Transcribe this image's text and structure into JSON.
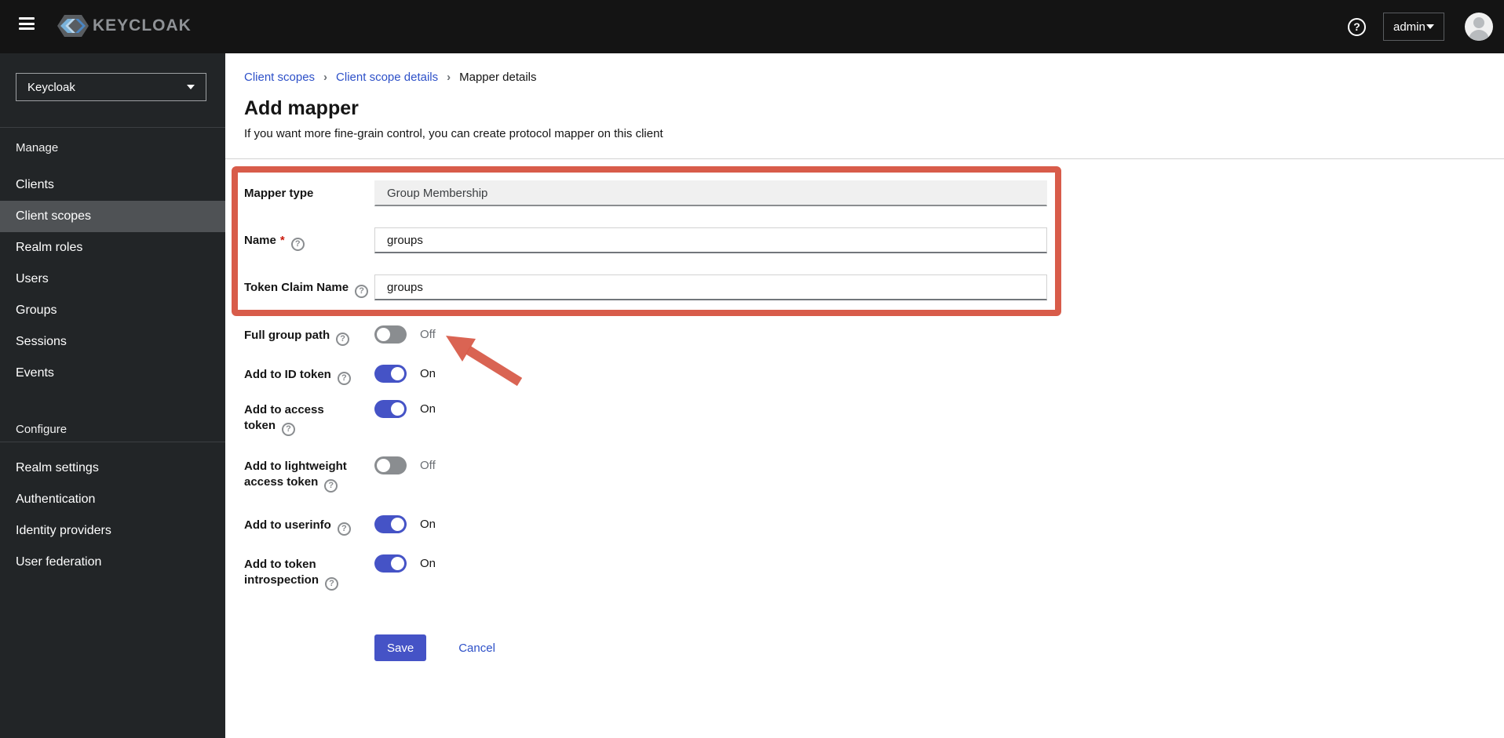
{
  "header": {
    "brand": "KEYCLOAK",
    "help_label": "?",
    "user_menu": "admin"
  },
  "sidebar": {
    "realm_selector": "Keycloak",
    "sections": [
      {
        "label": "Manage",
        "items": [
          {
            "label": "Clients",
            "selected": false
          },
          {
            "label": "Client scopes",
            "selected": true
          },
          {
            "label": "Realm roles",
            "selected": false
          },
          {
            "label": "Users",
            "selected": false
          },
          {
            "label": "Groups",
            "selected": false
          },
          {
            "label": "Sessions",
            "selected": false
          },
          {
            "label": "Events",
            "selected": false
          }
        ]
      },
      {
        "label": "Configure",
        "items": [
          {
            "label": "Realm settings",
            "selected": false
          },
          {
            "label": "Authentication",
            "selected": false
          },
          {
            "label": "Identity providers",
            "selected": false
          },
          {
            "label": "User federation",
            "selected": false
          }
        ]
      }
    ]
  },
  "breadcrumb": {
    "separator": "›",
    "items": [
      {
        "label": "Client scopes",
        "link": true
      },
      {
        "label": "Client scope details",
        "link": true
      },
      {
        "label": "Mapper details",
        "link": false
      }
    ]
  },
  "page": {
    "title": "Add mapper",
    "subtitle": "If you want more fine-grain control, you can create protocol mapper on this client"
  },
  "form": {
    "fields": [
      {
        "label": "Mapper type",
        "value": "Group Membership",
        "disabled": true,
        "required": false,
        "help": false
      },
      {
        "label": "Name",
        "value": "groups",
        "disabled": false,
        "required": true,
        "help": true
      },
      {
        "label": "Token Claim Name",
        "value": "groups",
        "disabled": false,
        "required": false,
        "help": true
      }
    ],
    "toggles": [
      {
        "label": "Full group path",
        "state": "Off",
        "on": false
      },
      {
        "label": "Add to ID token",
        "state": "On",
        "on": true
      },
      {
        "label": "Add to access token",
        "state": "On",
        "on": true
      },
      {
        "label": "Add to lightweight access token",
        "state": "Off",
        "on": false
      },
      {
        "label": "Add to userinfo",
        "state": "On",
        "on": true
      },
      {
        "label": "Add to token introspection",
        "state": "On",
        "on": true
      }
    ],
    "actions": {
      "save": "Save",
      "cancel": "Cancel"
    }
  },
  "annotations": {
    "highlight_color": "#d85c4a"
  },
  "colors": {
    "header_bg": "#141414",
    "sidebar_bg": "#222527",
    "selected_item_bg": "#4f5255",
    "primary": "#4553c6",
    "link": "#2d50c8",
    "annotation_red": "#d85c4a"
  }
}
